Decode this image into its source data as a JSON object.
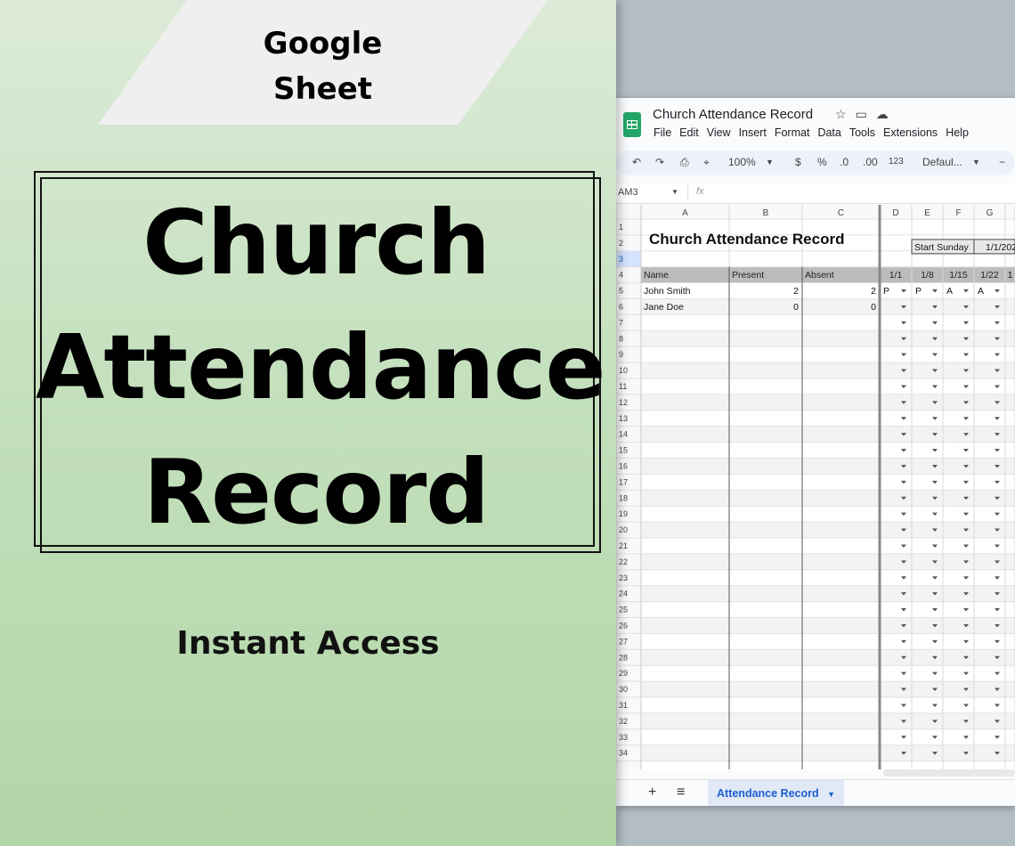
{
  "promo": {
    "banner_line1": "Google",
    "banner_line2": "Sheet",
    "title_line1": "Church",
    "title_line2": "Attendance",
    "title_line3": "Record",
    "subtitle": "Instant Access"
  },
  "sheet": {
    "doc_title": "Church Attendance Record",
    "title_icons": [
      "star-icon",
      "move-folder-icon",
      "cloud-status-icon"
    ],
    "menu": [
      "File",
      "Edit",
      "View",
      "Insert",
      "Format",
      "Data",
      "Tools",
      "Extensions",
      "Help"
    ],
    "toolbar": {
      "zoom": "100%",
      "currency": "$",
      "percent": "%",
      "decrease_decimal": ".0",
      "increase_decimal": ".00",
      "number_format": "123",
      "font": "Defaul...",
      "minus": "−"
    },
    "cell_ref": "AM3",
    "fx": "fx",
    "col_letters": [
      "A",
      "B",
      "C",
      "D",
      "E",
      "F",
      "G"
    ],
    "sheet_title": "Church Attendance Record",
    "start_label": "Start Sunday",
    "start_value": "1/1/202",
    "headers": [
      "Name",
      "Present",
      "Absent"
    ],
    "date_headers": [
      "1/1",
      "1/8",
      "1/15",
      "1/22",
      "1"
    ],
    "rows": [
      {
        "name": "John Smith",
        "present": "2",
        "absent": "2",
        "marks": [
          "P",
          "P",
          "A",
          "A"
        ]
      },
      {
        "name": "Jane Doe",
        "present": "0",
        "absent": "0",
        "marks": [
          "",
          "",
          "",
          ""
        ]
      }
    ],
    "row_numbers": [
      "1",
      "2",
      "3",
      "4",
      "5",
      "6",
      "7",
      "8",
      "9",
      "10",
      "11",
      "12",
      "13",
      "14",
      "15",
      "16",
      "17",
      "18",
      "19",
      "20",
      "21",
      "22",
      "23",
      "24",
      "25",
      "26",
      "27",
      "28",
      "29",
      "30",
      "31",
      "32",
      "33",
      "34"
    ],
    "tab_name": "Attendance Record",
    "add_sheet": "+",
    "all_sheets": "≡"
  },
  "colors": {
    "sheets_green": "#23a566",
    "header_fill": "#bcbcbc",
    "tab_blue": "#1a5fcc"
  }
}
